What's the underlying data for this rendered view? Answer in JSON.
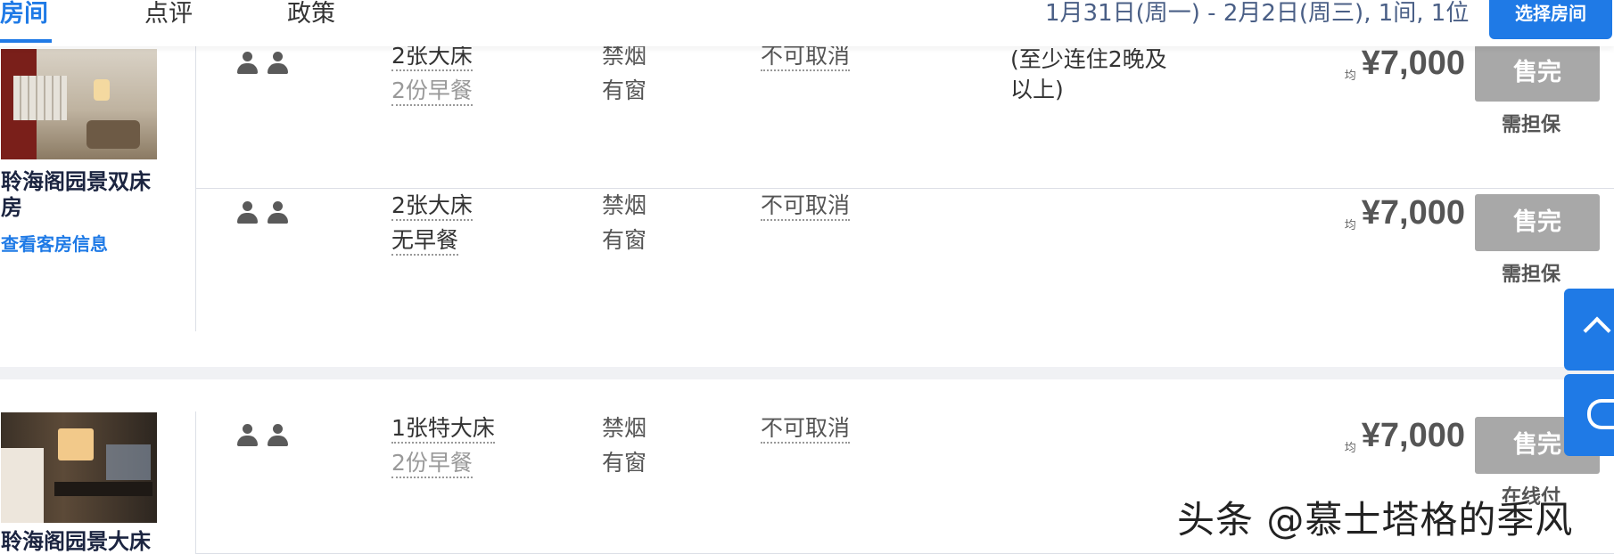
{
  "tabs": [
    {
      "label": "房间",
      "active": true
    },
    {
      "label": "点评",
      "active": false
    },
    {
      "label": "政策",
      "active": false
    }
  ],
  "search_summary": "1月31日(周一) - 2月2日(周三), 1间, 1位",
  "select_room_label": "选择房间",
  "rooms": [
    {
      "name": "聆海阁园景双床房",
      "view_link": "查看客房信息",
      "rates": [
        {
          "bed": "2张大床",
          "meal": "2份早餐",
          "smoking": "禁烟",
          "window": "有窗",
          "cancel": "不可取消",
          "note": "(至少连住2晚及以上)",
          "avg_label": "均",
          "price": "¥7,000",
          "status": "售完",
          "payment": "需担保"
        },
        {
          "bed": "2张大床",
          "meal": "无早餐",
          "smoking": "禁烟",
          "window": "有窗",
          "cancel": "不可取消",
          "note": "",
          "avg_label": "均",
          "price": "¥7,000",
          "status": "售完",
          "payment": "需担保"
        }
      ]
    },
    {
      "name": "聆海阁园景大床",
      "view_link": "",
      "rates": [
        {
          "bed": "1张特大床",
          "meal": "2份早餐",
          "smoking": "禁烟",
          "window": "有窗",
          "cancel": "不可取消",
          "note": "",
          "avg_label": "均",
          "price": "¥7,000",
          "status": "售完",
          "payment": "在线付"
        }
      ]
    }
  ],
  "icons": {
    "guest": "person-icon",
    "float_top": "chevron-up-icon",
    "float_service": "headset-icon"
  },
  "colors": {
    "accent": "#1f7ae6",
    "soldout": "#a8a8a8",
    "summary_text": "#4a5f86"
  },
  "watermark": "头条 @慕士塔格的季风"
}
